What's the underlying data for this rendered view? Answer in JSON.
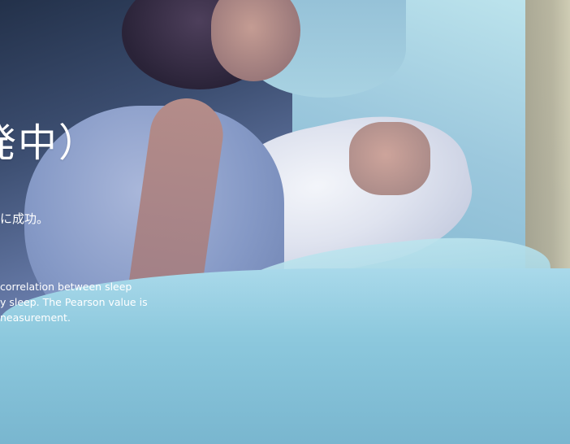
{
  "hero": {
    "title": "発中）",
    "subtitle": "に成功。",
    "description_lines": [
      "correlation between sleep",
      "y sleep. The Pearson value is",
      "neasurement."
    ]
  }
}
